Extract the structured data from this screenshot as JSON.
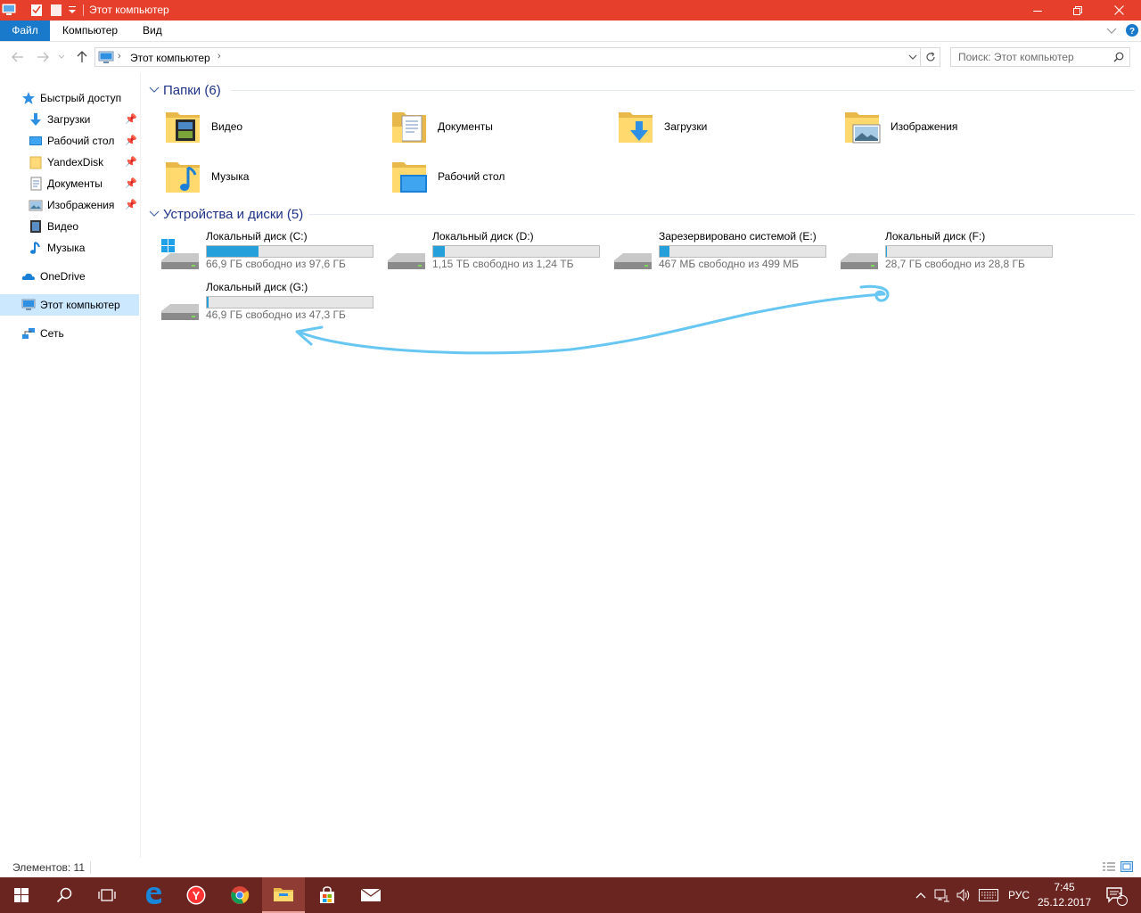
{
  "window": {
    "title": "Этот компьютер",
    "accent": "#e6402d"
  },
  "ribbon": {
    "tabs": [
      "Файл",
      "Компьютер",
      "Вид"
    ]
  },
  "address": {
    "crumb": "Этот компьютер"
  },
  "search": {
    "placeholder": "Поиск: Этот компьютер"
  },
  "sidebar": {
    "items": [
      {
        "label": "Быстрый доступ",
        "icon": "star-icon"
      },
      {
        "label": "Загрузки",
        "icon": "download-icon",
        "pinned": true
      },
      {
        "label": "Рабочий стол",
        "icon": "desktop-icon",
        "pinned": true
      },
      {
        "label": "YandexDisk",
        "icon": "folder-icon",
        "pinned": true
      },
      {
        "label": "Документы",
        "icon": "documents-icon",
        "pinned": true
      },
      {
        "label": "Изображения",
        "icon": "pictures-icon",
        "pinned": true
      },
      {
        "label": "Видео",
        "icon": "video-icon"
      },
      {
        "label": "Музыка",
        "icon": "music-icon"
      },
      {
        "label": "OneDrive",
        "icon": "onedrive-icon"
      },
      {
        "label": "Этот компьютер",
        "icon": "computer-icon",
        "selected": true
      },
      {
        "label": "Сеть",
        "icon": "network-icon"
      }
    ]
  },
  "folders": {
    "header": "Папки (6)",
    "items": [
      {
        "label": "Видео",
        "icon": "video-folder-icon"
      },
      {
        "label": "Документы",
        "icon": "documents-folder-icon"
      },
      {
        "label": "Загрузки",
        "icon": "downloads-folder-icon"
      },
      {
        "label": "Изображения",
        "icon": "pictures-folder-icon"
      },
      {
        "label": "Музыка",
        "icon": "music-folder-icon"
      },
      {
        "label": "Рабочий стол",
        "icon": "desktop-folder-icon"
      }
    ]
  },
  "drives": {
    "header": "Устройства и диски (5)",
    "items": [
      {
        "name": "Локальный диск (C:)",
        "free": "66,9 ГБ свободно из 97,6 ГБ",
        "used_fraction": 0.31,
        "icon": "windows-drive-icon"
      },
      {
        "name": "Локальный диск (D:)",
        "free": "1,15 ТБ свободно из 1,24 ТБ",
        "used_fraction": 0.07,
        "icon": "drive-icon"
      },
      {
        "name": "Зарезервировано системой (E:)",
        "free": "467 МБ свободно из 499 МБ",
        "used_fraction": 0.06,
        "icon": "drive-icon"
      },
      {
        "name": "Локальный диск (F:)",
        "free": "28,7 ГБ свободно из 28,8 ГБ",
        "used_fraction": 0.003,
        "icon": "drive-icon"
      },
      {
        "name": "Локальный диск (G:)",
        "free": "46,9 ГБ свободно из 47,3 ГБ",
        "used_fraction": 0.01,
        "icon": "drive-icon"
      }
    ]
  },
  "status": {
    "items_count": "Элементов: 11"
  },
  "taskbar": {
    "apps": [
      "start-icon",
      "search-icon",
      "task-view-icon",
      "edge-icon",
      "yandex-browser-icon",
      "chrome-icon",
      "file-explorer-icon",
      "store-icon",
      "mail-icon"
    ],
    "language": "РУС",
    "time": "7:45",
    "date": "25.12.2017",
    "notifications": "1"
  }
}
